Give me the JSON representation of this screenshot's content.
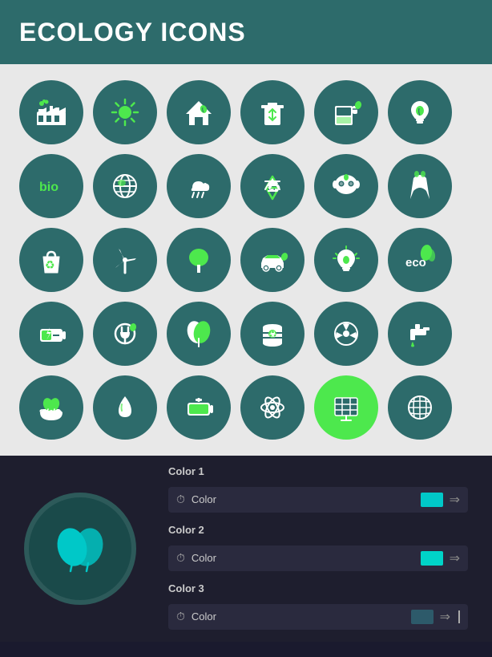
{
  "header": {
    "title": "ECOLOGY ICONS",
    "bg_color": "#2d6b6b"
  },
  "icons_area": {
    "bg_color": "#e8e8e8",
    "circle_color": "#2d6b6b",
    "icon_color_green": "#4de84d",
    "icon_color_white": "#ffffff"
  },
  "bottom_panel": {
    "bg_color": "#1e1e2e",
    "preview_circle_bg": "#1a4a4a",
    "color_controls": {
      "group1_label": "Color 1",
      "group1_row_label": "Color",
      "group1_swatch": "#00c8c8",
      "group2_label": "Color 2",
      "group2_row_label": "Color",
      "group2_swatch": "#00d4c8",
      "group3_label": "Color 3",
      "group3_row_label": "Color",
      "group3_swatch": "#2d5a6a"
    }
  }
}
